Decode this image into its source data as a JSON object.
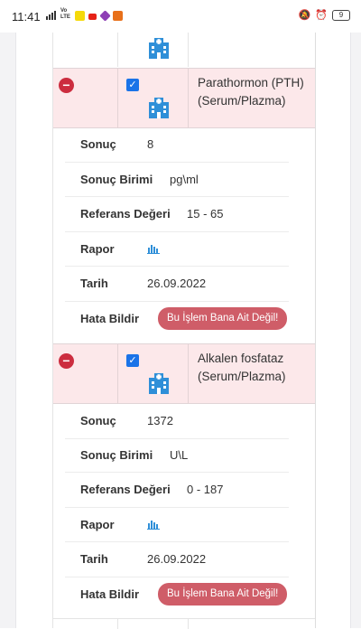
{
  "status_bar": {
    "time": "11:41",
    "network": "Vo LTE",
    "battery": "9"
  },
  "tests": [
    {
      "name": "Parathormon (PTH) (Serum/Plazma)",
      "name_line1": "Parathormon (PTH)",
      "name_line2": "(Serum/Plazma)",
      "details": {
        "result_label": "Sonuç",
        "result_value": "8",
        "unit_label": "Sonuç Birimi",
        "unit_value": "pg\\ml",
        "ref_label": "Referans Değeri",
        "ref_value": "15 - 65",
        "report_label": "Rapor",
        "date_label": "Tarih",
        "date_value": "26.09.2022",
        "error_label": "Hata Bildir",
        "error_button": "Bu İşlem Bana Ait Değil!"
      }
    },
    {
      "name": "Alkalen fosfataz (Serum/Plazma)",
      "name_line1": "Alkalen fosfataz",
      "name_line2": "(Serum/Plazma)",
      "details": {
        "result_label": "Sonuç",
        "result_value": "1372",
        "unit_label": "Sonuç Birimi",
        "unit_value": "U\\L",
        "ref_label": "Referans Değeri",
        "ref_value": "0 - 187",
        "report_label": "Rapor",
        "date_label": "Tarih",
        "date_value": "26.09.2022",
        "error_label": "Hata Bildir",
        "error_button": "Bu İşlem Bana Ait Değil!"
      }
    }
  ],
  "icons": {
    "remove": "minus-circle-icon",
    "select": "checkbox-checked-icon",
    "institution": "hospital-icon",
    "report": "bar-chart-icon"
  },
  "colors": {
    "row_highlight": "#fce8ea",
    "remove_red": "#cc2d3f",
    "checkbox_blue": "#1a73e8",
    "error_button": "#cf5d68",
    "icon_blue": "#2f8fd8"
  }
}
